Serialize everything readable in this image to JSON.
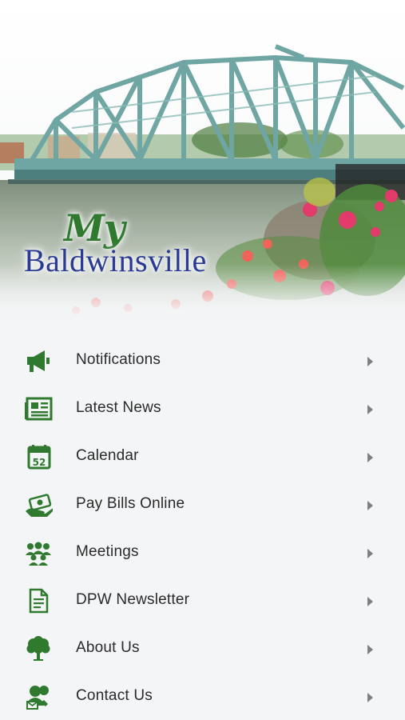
{
  "header": {
    "logo_line1": "My",
    "logo_line2": "Baldwinsville"
  },
  "colors": {
    "icon_green": "#2f7a2f",
    "logo_blue": "#2b3b93",
    "bridge_teal": "#6fa6a3"
  },
  "menu": {
    "items": [
      {
        "label": "Notifications",
        "icon": "megaphone-icon"
      },
      {
        "label": "Latest News",
        "icon": "newspaper-icon"
      },
      {
        "label": "Calendar",
        "icon": "calendar-icon",
        "icon_text": "52"
      },
      {
        "label": "Pay Bills Online",
        "icon": "money-hand-icon"
      },
      {
        "label": "Meetings",
        "icon": "group-icon"
      },
      {
        "label": "DPW Newsletter",
        "icon": "document-icon"
      },
      {
        "label": "About Us",
        "icon": "tree-icon"
      },
      {
        "label": "Contact Us",
        "icon": "contact-icon"
      }
    ]
  }
}
